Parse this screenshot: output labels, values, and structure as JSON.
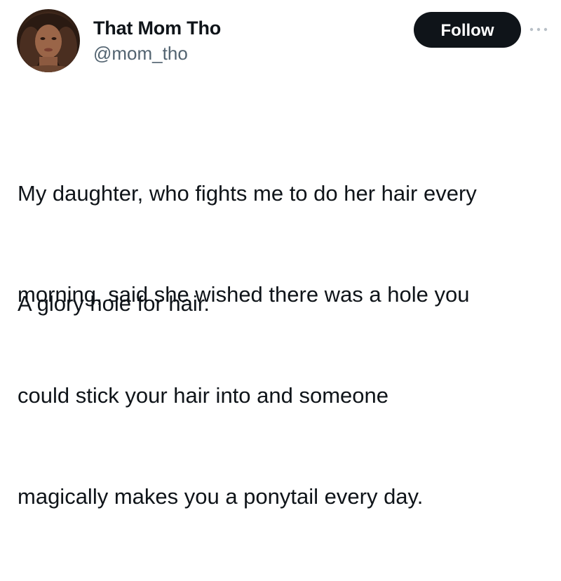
{
  "author": {
    "display_name": "That Mom Tho",
    "handle": "@mom_tho",
    "avatar_icon": "profile-photo"
  },
  "actions": {
    "follow_label": "Follow",
    "more_icon": "more-horizontal-icon"
  },
  "tweet": {
    "lines": [
      "My daughter, who fights me to do her hair every",
      "morning, said she wished there was a hole you",
      "could stick your hair into and someone",
      "magically makes you a ponytail every day."
    ],
    "punchline": "A glory hole for hair."
  },
  "colors": {
    "text": "#0f1419",
    "secondary": "#536471",
    "button_bg": "#0f1419",
    "button_text": "#ffffff"
  }
}
